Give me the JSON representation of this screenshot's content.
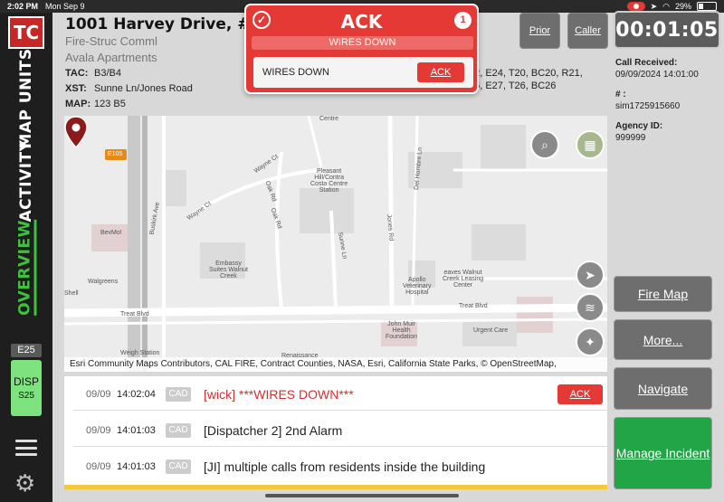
{
  "status_bar": {
    "time": "2:02 PM",
    "date": "Mon Sep 9",
    "battery": "29%"
  },
  "sidebar": {
    "logo": "TC",
    "tabs": [
      {
        "label": "MAP UNITS",
        "active": false
      },
      {
        "label": "ACTIVITY",
        "active": false
      },
      {
        "label": "OVERVIEW",
        "active": true
      }
    ],
    "unit": "E25",
    "disp_label": "DISP",
    "disp_unit": "S25"
  },
  "header": {
    "address": "1001 Harvey Drive, # 317,",
    "type": "Fire-Struc Comml",
    "place": "Avala Apartments",
    "tac_label": "TAC:",
    "tac": "B3/B4",
    "xst_label": "XST:",
    "xst": "Sunne Ln/Jones Road",
    "map_label": "MAP:",
    "map": "123 B5",
    "units_line1": "22, E24, T20, BC20, R21,",
    "units_line2": "26, E27, T26, BC26"
  },
  "buttons": {
    "prior": "Prior",
    "caller": "Caller"
  },
  "timer": "00:01:05",
  "call_info": {
    "received_label": "Call Received:",
    "received": "09/09/2024 14:01:00",
    "num_label": "# :",
    "num": "sim1725915660",
    "agency_label": "Agency ID:",
    "agency": "999999"
  },
  "ack_popup": {
    "title": "ACK",
    "count": "1",
    "subtitle": "WIRES DOWN",
    "message": "WIRES DOWN",
    "button": "ACK"
  },
  "map": {
    "attribution": "Esri Community Maps Contributors, CAL FIRE, Contract Counties, NASA, Esri, California State Parks, © OpenStreetMap,",
    "labels": {
      "hwy": "E105",
      "wayne1": "Wayne Ct",
      "wayne2": "Wayne Ct",
      "oakrd1": "Oak Rd",
      "oakrd2": "Oak Rd",
      "buskirk": "Buskirk Ave",
      "bevmo": "BevMo!",
      "walgreens": "Walgreens",
      "embassy": "Embassy\nSuites Walnut\nCreek",
      "bart": "Pleasant\nHill/Contra\nCosta Centre\nStation",
      "sunne": "Sunne Ln",
      "jones": "Jones Rd",
      "delhombre": "Del Hombre Ln",
      "apollo": "Apollo\nVeterinary\nHospital",
      "leaves": "eaves Walnut\nCreek Leasing\nCenter",
      "treat1": "Treat Blvd",
      "treat2": "Treat Blvd",
      "johnmuir": "John Muir\nHealth\nFoundation",
      "urgent": "Urgent Care",
      "weigh": "Weigh Station",
      "renaissance": "Renaissance",
      "shell": "Shell",
      "centre": "Centre"
    }
  },
  "log": [
    {
      "date": "09/09",
      "time": "14:02:04",
      "tag": "CAD",
      "message": "[wick] ***WIRES DOWN***",
      "alert": true,
      "button": "ACK"
    },
    {
      "date": "09/09",
      "time": "14:01:03",
      "tag": "CAD",
      "message": "[Dispatcher 2] 2nd Alarm",
      "alert": false
    },
    {
      "date": "09/09",
      "time": "14:01:03",
      "tag": "CAD",
      "message": "[JI] multiple calls from residents inside the building",
      "alert": false
    }
  ],
  "actions": {
    "fire_map": "Fire Map",
    "more": "More...",
    "navigate": "Navigate",
    "manage": "Manage Incident"
  }
}
